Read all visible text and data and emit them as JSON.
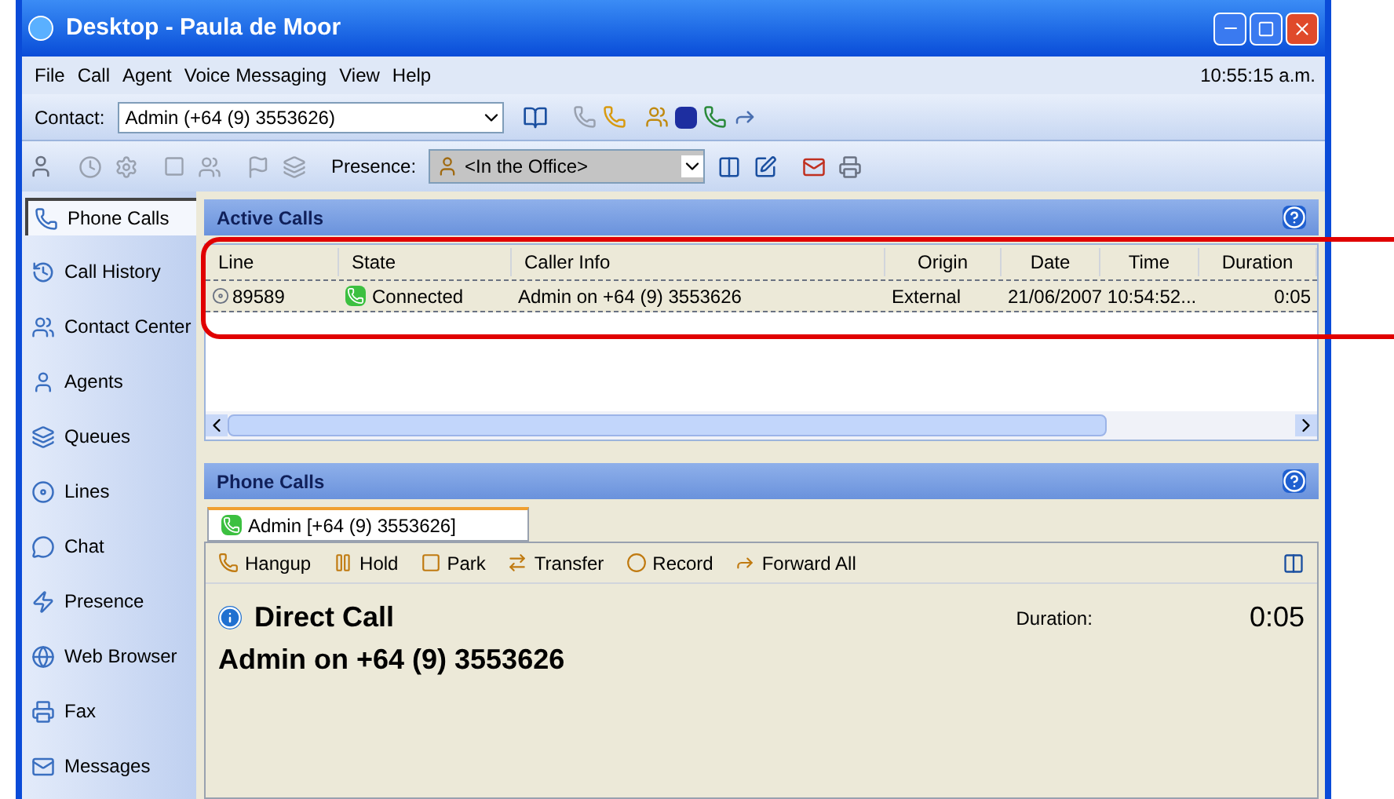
{
  "window": {
    "title": "Desktop - Paula de Moor"
  },
  "menu": [
    "File",
    "Call",
    "Agent",
    "Voice Messaging",
    "View",
    "Help"
  ],
  "clock": "10:55:15 a.m.",
  "contact_bar": {
    "label": "Contact:",
    "value": "Admin (+64 (9) 3553626)"
  },
  "presence_bar": {
    "label": "Presence:",
    "value": "<In the Office>"
  },
  "sidebar": {
    "items": [
      {
        "label": "Phone Calls",
        "selected": true
      },
      {
        "label": "Call History",
        "selected": false
      },
      {
        "label": "Contact Center",
        "selected": false
      },
      {
        "label": "Agents",
        "selected": false
      },
      {
        "label": "Queues",
        "selected": false
      },
      {
        "label": "Lines",
        "selected": false
      },
      {
        "label": "Chat",
        "selected": false
      },
      {
        "label": "Presence",
        "selected": false
      },
      {
        "label": "Web Browser",
        "selected": false
      },
      {
        "label": "Fax",
        "selected": false
      },
      {
        "label": "Messages",
        "selected": false
      }
    ]
  },
  "active_calls": {
    "title": "Active Calls",
    "columns": [
      "Line",
      "State",
      "Caller Info",
      "Origin",
      "Date",
      "Time",
      "Duration"
    ],
    "rows": [
      {
        "line": "89589",
        "state": "Connected",
        "caller_info": "Admin on +64 (9) 3553626",
        "origin": "External",
        "date_time": "21/06/2007 10:54:52...",
        "duration": "0:05"
      }
    ]
  },
  "phone_calls": {
    "title": "Phone Calls",
    "tabs": [
      {
        "label": "Admin [+64 (9) 3553626]",
        "selected": true
      }
    ],
    "actions": [
      "Hangup",
      "Hold",
      "Park",
      "Transfer",
      "Record",
      "Forward All"
    ],
    "call_type": "Direct Call",
    "caller": "Admin on +64 (9) 3553626",
    "duration_label": "Duration:",
    "duration": "0:05"
  }
}
